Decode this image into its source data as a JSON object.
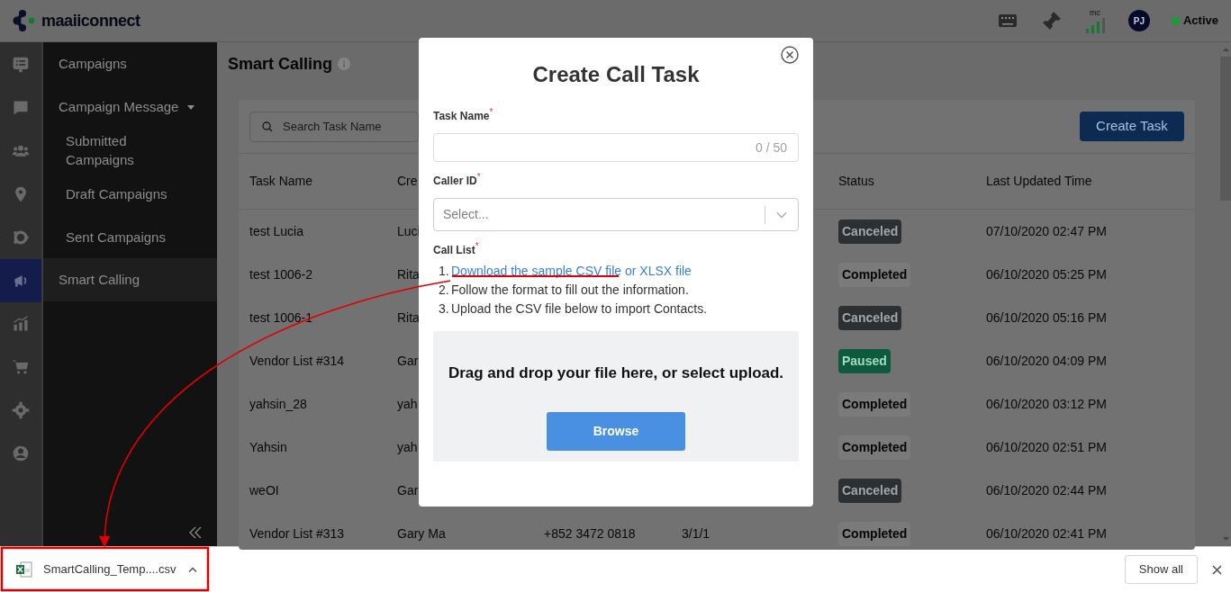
{
  "topbar": {
    "logo": "maaiiconnect",
    "signal_label": "mc",
    "avatar": "PJ",
    "presence": {
      "label": "Active",
      "color": "#1a9a3a"
    }
  },
  "nav_rail": [
    {
      "selected": false
    },
    {
      "selected": false
    },
    {
      "selected": false
    },
    {
      "selected": false
    },
    {
      "selected": false
    },
    {
      "selected": true
    },
    {
      "selected": false
    },
    {
      "selected": false
    },
    {
      "selected": false
    },
    {
      "selected": false
    }
  ],
  "sidebar": {
    "items": [
      {
        "label": "Campaigns",
        "selected": false
      },
      {
        "label": "Campaign Message",
        "expanded": true,
        "children": [
          {
            "label": "Submitted Campaigns"
          },
          {
            "label": "Draft Campaigns"
          },
          {
            "label": "Sent Campaigns"
          }
        ]
      },
      {
        "label": "Smart Calling",
        "selected": true
      }
    ]
  },
  "page": {
    "title": "Smart Calling",
    "search": {
      "placeholder": "Search Task Name"
    },
    "create_button": "Create Task"
  },
  "table": {
    "columns": [
      "Task Name",
      "Cre",
      "Status",
      "Last Updated Time"
    ],
    "rows": [
      {
        "task_name": "test Lucia",
        "creator": "Luci",
        "status": {
          "label": "Canceled",
          "kind": "canceled"
        },
        "updated": "07/10/2020 02:47 PM"
      },
      {
        "task_name": "test 1006-2",
        "creator": "Rita",
        "status": {
          "label": "Completed",
          "kind": "completed"
        },
        "updated": "06/10/2020 05:25 PM"
      },
      {
        "task_name": "test 1006-1",
        "creator": "Rita",
        "status": {
          "label": "Canceled",
          "kind": "canceled"
        },
        "updated": "06/10/2020 05:16 PM"
      },
      {
        "task_name": "Vendor List #314",
        "creator": "Gar",
        "status": {
          "label": "Paused",
          "kind": "paused"
        },
        "updated": "06/10/2020 04:09 PM"
      },
      {
        "task_name": "yahsin_28",
        "creator": "yah",
        "status": {
          "label": "Completed",
          "kind": "completed"
        },
        "updated": "06/10/2020 03:12 PM"
      },
      {
        "task_name": "Yahsin",
        "creator": "yah",
        "status": {
          "label": "Completed",
          "kind": "completed"
        },
        "updated": "06/10/2020 02:51 PM"
      },
      {
        "task_name": "weOI",
        "creator": "Gar",
        "status": {
          "label": "Canceled",
          "kind": "canceled"
        },
        "updated": "06/10/2020 02:44 PM"
      },
      {
        "task_name": "Vendor List #313",
        "creator": "Gary Ma",
        "column_3": "+852 3472 0818",
        "column_4": "3/1/1",
        "status": {
          "label": "Completed",
          "kind": "completed"
        },
        "updated": "06/10/2020 02:41 PM"
      }
    ]
  },
  "modal": {
    "title": "Create Call Task",
    "task_name": {
      "label": "Task Name",
      "required_mark": "*",
      "counter": "0 / 50"
    },
    "caller_id": {
      "label": "Caller ID",
      "required_mark": "*",
      "placeholder": "Select..."
    },
    "call_list": {
      "label": "Call List",
      "required_mark": "*",
      "steps": [
        {
          "number": "1.",
          "text": "Download the sample CSV file or XLSX file",
          "kind": "link"
        },
        {
          "number": "2.",
          "text": "Follow the format to fill out the information.",
          "kind": "text"
        },
        {
          "number": "3.",
          "text": "Upload the CSV file below to import Contacts.",
          "kind": "text"
        }
      ]
    },
    "dropzone": {
      "text": "Drag and drop your file here, or select upload.",
      "button": "Browse"
    }
  },
  "downloads": {
    "file": "SmartCalling_Temp....csv",
    "show_all": "Show all"
  }
}
